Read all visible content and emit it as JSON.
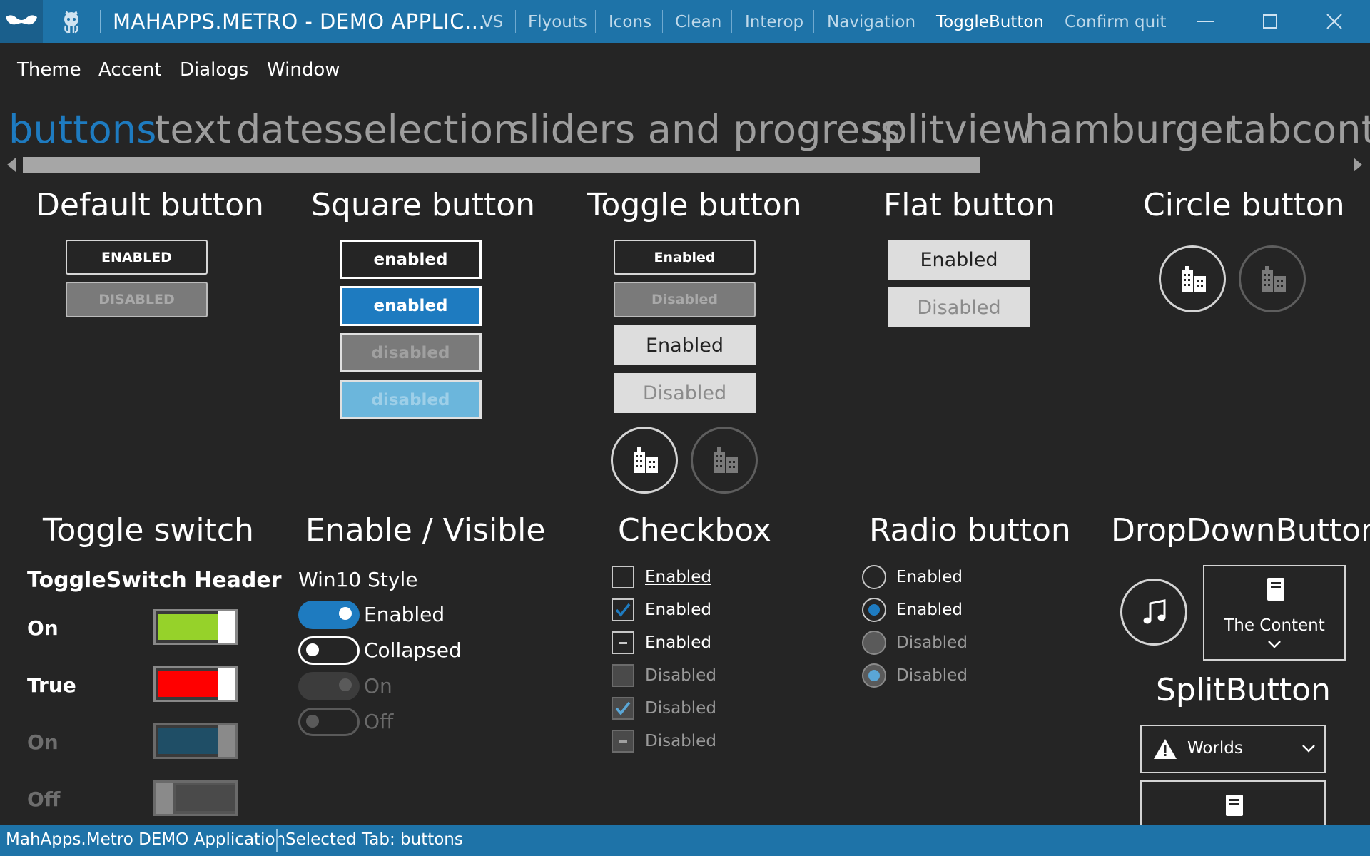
{
  "window": {
    "title": "MAHAPPS.METRO - DEMO APPLIC...",
    "commands": [
      "VS",
      "Flyouts",
      "Icons",
      "Clean",
      "Interop",
      "Navigation",
      "ToggleButton",
      "Confirm quit"
    ]
  },
  "menu": [
    "Theme",
    "Accent",
    "Dialogs",
    "Window"
  ],
  "tabs": [
    "buttons",
    "text",
    "dates",
    "selection",
    "sliders and progress",
    "splitview",
    "hamburger",
    "tabcontr"
  ],
  "sections": {
    "default_button": {
      "title": "Default button",
      "enabled": "ENABLED",
      "disabled": "DISABLED"
    },
    "square_button": {
      "title": "Square button",
      "labels": [
        "enabled",
        "enabled",
        "disabled",
        "disabled"
      ]
    },
    "toggle_button": {
      "title": "Toggle button",
      "labels": [
        "Enabled",
        "Disabled",
        "Enabled",
        "Disabled"
      ]
    },
    "flat_button": {
      "title": "Flat button",
      "enabled": "Enabled",
      "disabled": "Disabled"
    },
    "circle_button": {
      "title": "Circle button"
    },
    "toggle_switch": {
      "title": "Toggle switch",
      "header": "ToggleSwitch Header",
      "rows": [
        {
          "label": "On",
          "color": "#96D22A",
          "disabled": false
        },
        {
          "label": "True",
          "color": "#FF0000",
          "disabled": false
        },
        {
          "label": "On",
          "color": "#1F4E66",
          "disabled": true
        },
        {
          "label": "Off",
          "color": "#555555",
          "disabled": true
        }
      ]
    },
    "enable_visible": {
      "title": "Enable / Visible",
      "subheader": "Win10 Style",
      "items": [
        "Enabled",
        "Collapsed",
        "On",
        "Off"
      ]
    },
    "checkbox": {
      "title": "Checkbox",
      "items": [
        "Enabled",
        "Enabled",
        "Enabled",
        "Disabled",
        "Disabled",
        "Disabled"
      ]
    },
    "radio_button": {
      "title": "Radio button",
      "items": [
        "Enabled",
        "Enabled",
        "Disabled",
        "Disabled"
      ]
    },
    "dropdown_button": {
      "title": "DropDownButton",
      "content": "The Content"
    },
    "split_button": {
      "title": "SplitButton",
      "selected": "Worlds"
    }
  },
  "status": {
    "app": "MahApps.Metro DEMO Application",
    "selected_tab": "Selected Tab:  buttons"
  },
  "colors": {
    "accent": "#1E73A8",
    "background": "#252525"
  }
}
